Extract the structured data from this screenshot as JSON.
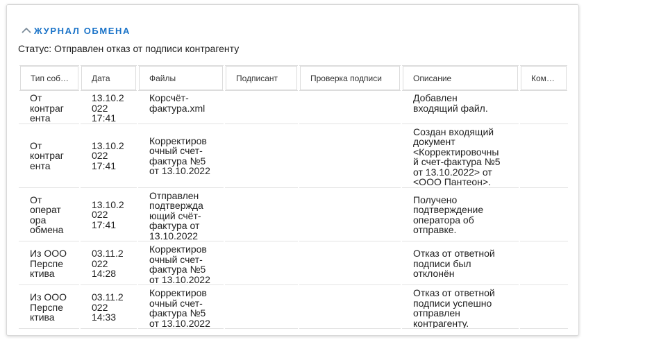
{
  "panel": {
    "title": "ЖУРНАЛ ОБМЕНА",
    "status": "Статус: Отправлен отказ от подписи контрагенту"
  },
  "table": {
    "columns": [
      "Тип соб…",
      "Дата",
      "Файлы",
      "Подписант",
      "Проверка подписи",
      "Описание",
      "Ком…"
    ],
    "rows": [
      {
        "type": "От\nконтраг\nента",
        "date": "13.10.2\n022\n17:41",
        "files": "Корсчёт-\nфактура.xml",
        "signer": "",
        "check": "",
        "description": "Добавлен\nвходящий файл.",
        "comment": ""
      },
      {
        "type": "От\nконтраг\nента",
        "date": "13.10.2\n022\n17:41",
        "files": "Корректиров\nочный счет-\nфактура №5\nот 13.10.2022",
        "signer": "",
        "check": "",
        "description": "Создан входящий\nдокумент\n<Корректировочны\nй счет-фактура №5\nот 13.10.2022> от\n<ООО Пантеон>.",
        "comment": ""
      },
      {
        "type": "От\nоперат\nора\nобмена",
        "date": "13.10.2\n022\n17:41",
        "files": "Отправлен\nподтвержда\nющий счёт-\nфактура от\n13.10.2022",
        "signer": "",
        "check": "",
        "description": "Получено\nподтверждение\nоператора об\nотправке.",
        "comment": ""
      },
      {
        "type": "Из ООО\nПерспе\nктива",
        "date": "03.11.2\n022\n14:28",
        "files": "Корректиров\nочный счет-\nфактура №5\nот 13.10.2022",
        "signer": "",
        "check": "",
        "description": "Отказ от ответной\nподписи был\nотклонён",
        "comment": ""
      },
      {
        "type": "Из ООО\nПерспе\nктива",
        "date": "03.11.2\n022\n14:33",
        "files": "Корректиров\nочный счет-\nфактура №5\nот 13.10.2022",
        "signer": "",
        "check": "",
        "description": "Отказ от ответной\nподписи успешно\nотправлен\nконтрагенту.",
        "comment": ""
      }
    ]
  },
  "icons": {
    "collapse": "chevron-up-icon"
  },
  "colors": {
    "accent": "#1a73c8",
    "border": "#dcdcdc"
  }
}
